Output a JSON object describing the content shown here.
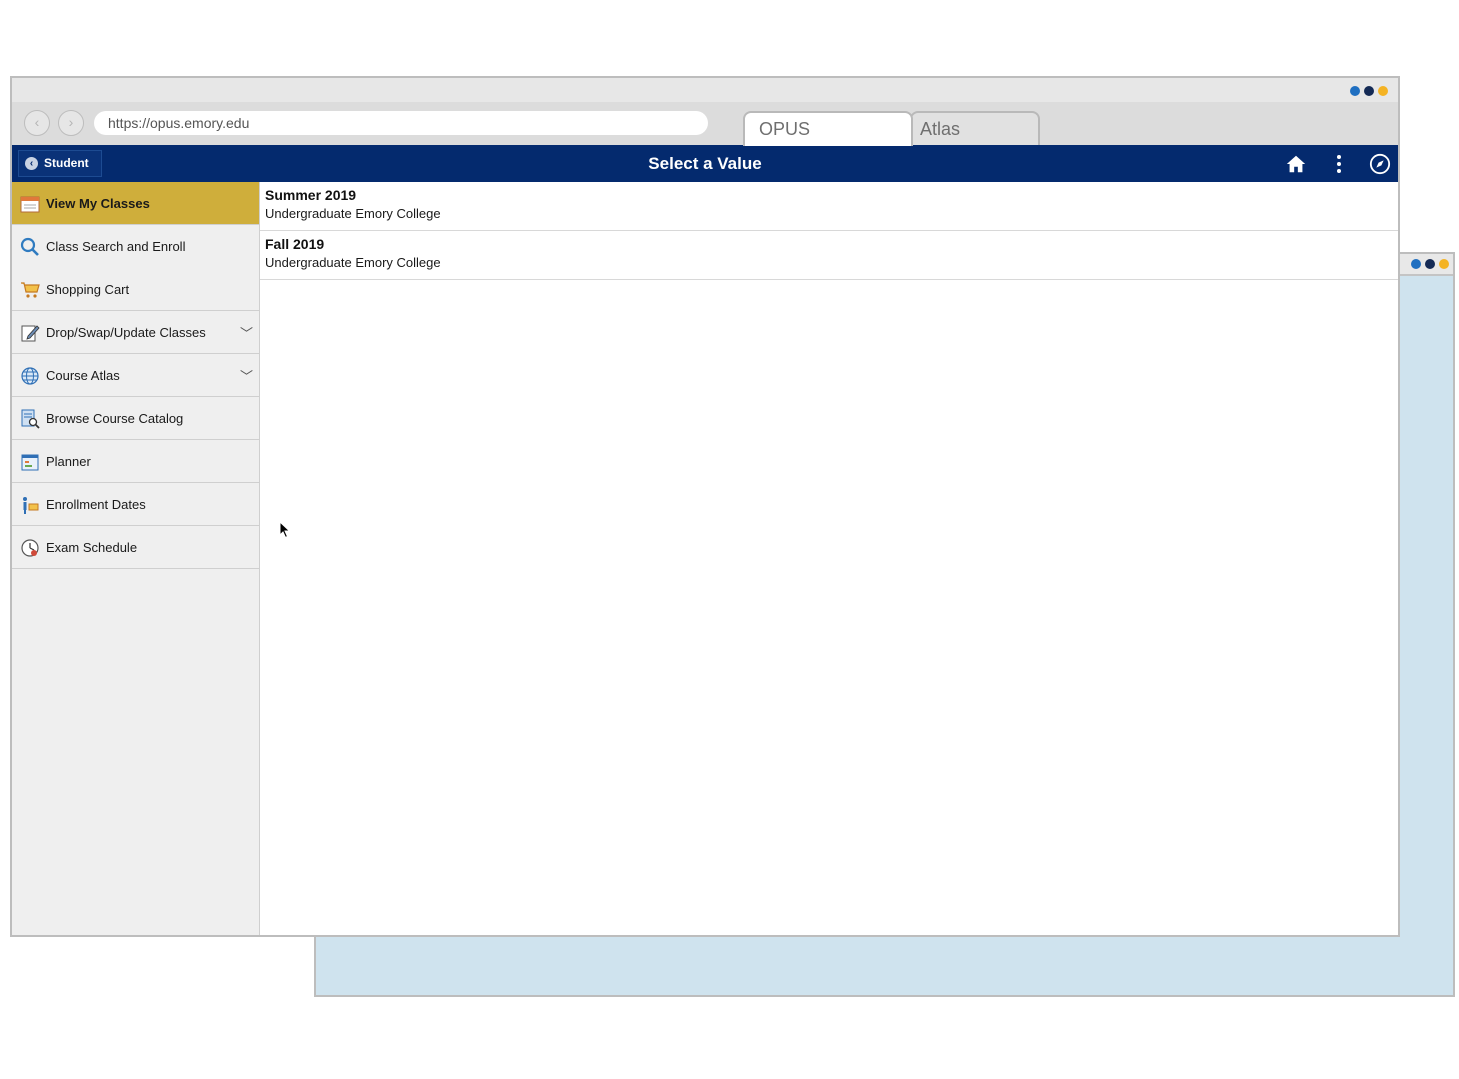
{
  "colors": {
    "header_bg": "#042a6e",
    "active_item": "#cfae3b",
    "dot_blue": "#1f6fc1",
    "dot_navy": "#142a55",
    "dot_amber": "#f4b324",
    "bg_window": "#cfe3ee"
  },
  "browser": {
    "url": "https://opus.emory.edu",
    "tabs": [
      {
        "label": "OPUS",
        "active": true
      },
      {
        "label": "Atlas",
        "active": false
      }
    ]
  },
  "header": {
    "back_label": "Student",
    "title": "Select a Value",
    "icons": [
      "home-icon",
      "more-vertical-icon",
      "compass-icon"
    ]
  },
  "sidebar": {
    "items": [
      {
        "label": "View My Classes",
        "icon": "calendar-icon",
        "active": true
      },
      {
        "label": "Class Search and Enroll",
        "icon": "search-icon"
      },
      {
        "label": "Shopping Cart",
        "icon": "cart-icon"
      },
      {
        "label": "Drop/Swap/Update Classes",
        "icon": "edit-icon",
        "expandable": true
      },
      {
        "label": "Course Atlas",
        "icon": "globe-icon",
        "expandable": true
      },
      {
        "label": "Browse Course Catalog",
        "icon": "catalog-icon"
      },
      {
        "label": "Planner",
        "icon": "planner-icon"
      },
      {
        "label": "Enrollment Dates",
        "icon": "enrollment-icon"
      },
      {
        "label": "Exam Schedule",
        "icon": "clock-icon"
      }
    ]
  },
  "terms": [
    {
      "title": "Summer 2019",
      "subtitle": "Undergraduate Emory College"
    },
    {
      "title": "Fall 2019",
      "subtitle": "Undergraduate Emory College"
    }
  ]
}
